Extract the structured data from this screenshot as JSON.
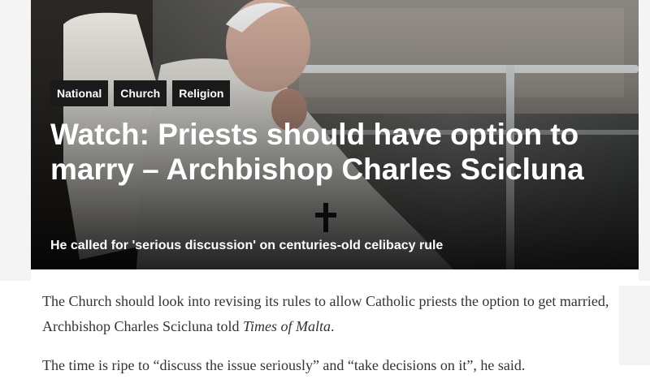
{
  "tags": [
    "National",
    "Church",
    "Religion"
  ],
  "headline": "Watch: Priests should have option to marry – Archbishop Charles Scicluna",
  "subheadline": "He called for 'serious discussion' on centuries-old celibacy rule",
  "article": {
    "p1_text": "The Church should look into revising its rules to allow Catholic priests the option to get married, Archbishop Charles Scicluna told ",
    "p1_publication": "Times of Malta",
    "p1_end": ".",
    "p2_text": "The time is ripe to “discuss the issue seriously” and “take decisions on it”, he said."
  },
  "colors": {
    "tag_bg": "#1a1a1a",
    "headline": "#ffffff",
    "body_text": "#333333"
  }
}
